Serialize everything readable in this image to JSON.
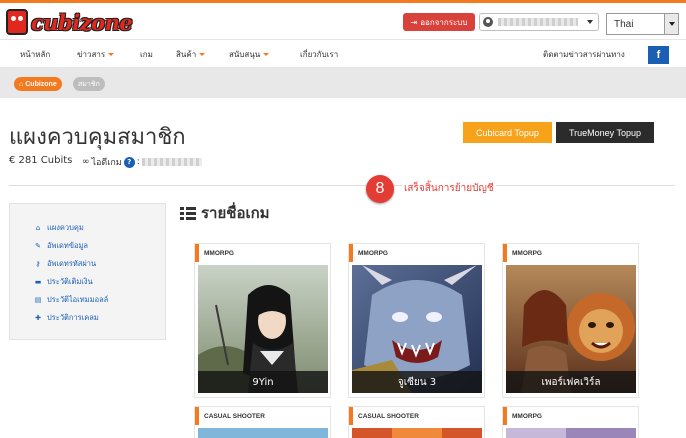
{
  "header": {
    "logo_text": "cubizone",
    "logout_label": "ออกจากระบบ",
    "language": "Thai"
  },
  "nav": {
    "items": [
      {
        "label": "หน้าหลัก",
        "dropdown": false
      },
      {
        "label": "ข่าวสาร",
        "dropdown": true
      },
      {
        "label": "เกม",
        "dropdown": false
      },
      {
        "label": "สินค้า",
        "dropdown": true
      },
      {
        "label": "สนับสนุน",
        "dropdown": true
      },
      {
        "label": "เกี่ยวกับเรา",
        "dropdown": false
      }
    ],
    "follow_text": "ติดตามข่าวสารผ่านทาง",
    "facebook_label": "f"
  },
  "breadcrumb": {
    "home": "Cubizone",
    "current": "สมาชิก"
  },
  "page": {
    "title": "แผงควบคุมสมาชิก",
    "cubits": "€ 281 Cubits",
    "game_id_label": "ไอดีเกม",
    "help": "?",
    "topup_cubicard": "Cubicard Topup",
    "topup_truemoney": "TrueMoney Topup"
  },
  "notice": {
    "step": "8",
    "text": "เสร็จสิ้นการย้ายบัญชี"
  },
  "sidebar": {
    "items": [
      {
        "label": "แผงควบคุม",
        "icon": "home-icon"
      },
      {
        "label": "อัพเดทข้อมูล",
        "icon": "edit-icon"
      },
      {
        "label": "อัพเดทรหัสผ่าน",
        "icon": "key-icon"
      },
      {
        "label": "ประวัติเติมเงิน",
        "icon": "card-icon"
      },
      {
        "label": "ประวัติไอเทมมอลล์",
        "icon": "cart-icon"
      },
      {
        "label": "ประวัติการเคลม",
        "icon": "gift-icon"
      }
    ]
  },
  "games": {
    "heading": "รายชื่อเกม",
    "cards": [
      {
        "category": "MMORPG",
        "name": "9Yin"
      },
      {
        "category": "MMORPG",
        "name": "จูเซียน 3"
      },
      {
        "category": "MMORPG",
        "name": "เพอร์เฟคเวิร์ล"
      },
      {
        "category": "CASUAL SHOOTER",
        "name": ""
      },
      {
        "category": "CASUAL SHOOTER",
        "name": ""
      },
      {
        "category": "MMORPG",
        "name": ""
      }
    ]
  },
  "colors": {
    "accent": "#f47a20",
    "logout": "#d9413b",
    "link": "#1a5fb4",
    "notice": "#e23c34"
  }
}
